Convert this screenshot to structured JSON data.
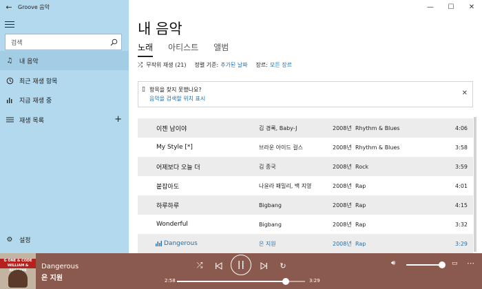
{
  "app": {
    "title": "Groove 음악"
  },
  "sidebar": {
    "search_placeholder": "검색",
    "items": [
      {
        "label": "내 음악",
        "icon": "music-note-icon"
      },
      {
        "label": "최근 재생 항목",
        "icon": "clock-icon"
      },
      {
        "label": "지금 재생 중",
        "icon": "bars-icon"
      }
    ],
    "playlists_label": "재생 목록",
    "settings_label": "설정"
  },
  "main": {
    "title": "내 음악",
    "tabs": [
      {
        "label": "노래"
      },
      {
        "label": "아티스트"
      },
      {
        "label": "앨범"
      }
    ],
    "filters": {
      "shuffle": "무작위 재생 (21)",
      "sort_label": "정렬 기준:",
      "sort_value": "추가된 날짜",
      "genre_label": "장르:",
      "genre_value": "모든 장르"
    },
    "notice": {
      "title": "항목을 찾지 못했나요?",
      "link": "음악을 검색할 위치 표시"
    },
    "songs": [
      {
        "title": "이젠 남이야",
        "artist": "김 경록, Baby-J",
        "year": "2008년",
        "genre": "Rhythm & Blues",
        "duration": "4:06"
      },
      {
        "title": "My Style [*]",
        "artist": "브라운 아이드 걸스",
        "year": "2008년",
        "genre": "Rhythm & Blues",
        "duration": "3:58"
      },
      {
        "title": "어제보다 오늘 더",
        "artist": "김 종국",
        "year": "2008년",
        "genre": "Rock",
        "duration": "3:59"
      },
      {
        "title": "붙잡아도",
        "artist": "나윤라 패밀리, 백 지영",
        "year": "2008년",
        "genre": "Rap",
        "duration": "4:01"
      },
      {
        "title": "하루하루",
        "artist": "Bigbang",
        "year": "2008년",
        "genre": "Rap",
        "duration": "4:15"
      },
      {
        "title": "Wonderful",
        "artist": "Bigbang",
        "year": "2008년",
        "genre": "Rap",
        "duration": "3:32"
      },
      {
        "title": "Dangerous",
        "artist": "은 지원",
        "year": "2008년",
        "genre": "Rap",
        "duration": "3:29",
        "playing": true
      }
    ]
  },
  "player": {
    "song_title": "Dangerous",
    "artist": "은 지원",
    "album_art_text": "G ONE & CODE WILLIAM & RESERVE",
    "time_current": "2:58",
    "time_total": "3:29",
    "progress": 0.85,
    "volume": 1.0
  },
  "colors": {
    "sidebar_bg": "#b3d9ee",
    "accent": "#1b6fb0",
    "player_bg": "#8a5a4e"
  }
}
